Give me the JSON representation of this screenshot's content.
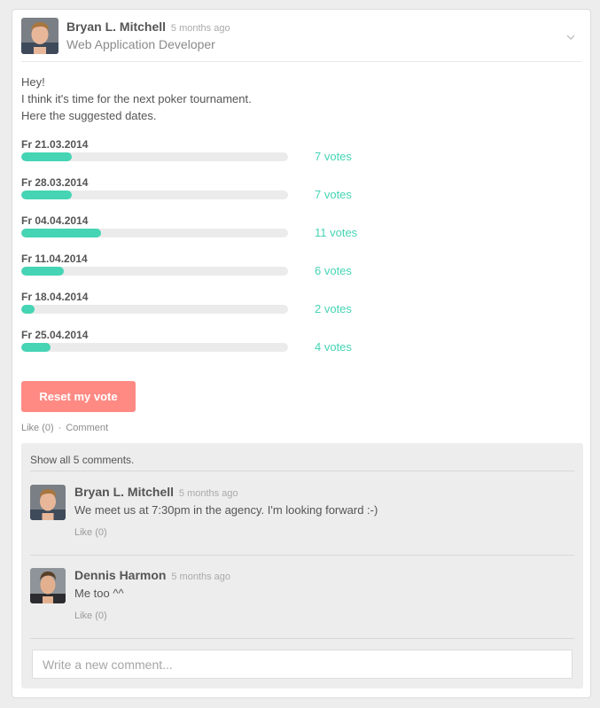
{
  "post": {
    "author": "Bryan L. Mitchell",
    "time": "5 months ago",
    "role": "Web Application Developer",
    "message": [
      "Hey!",
      "I think it's time for the next poker tournament.",
      "Here the suggested dates."
    ]
  },
  "poll": {
    "fill_color": "#45d4b4",
    "options": [
      {
        "date": "Fr 21.03.2014",
        "votes_label": "7 votes",
        "fill": 0.19
      },
      {
        "date": "Fr 28.03.2014",
        "votes_label": "7 votes",
        "fill": 0.19
      },
      {
        "date": "Fr 04.04.2014",
        "votes_label": "11 votes",
        "fill": 0.3
      },
      {
        "date": "Fr 11.04.2014",
        "votes_label": "6 votes",
        "fill": 0.16
      },
      {
        "date": "Fr 18.04.2014",
        "votes_label": "2 votes",
        "fill": 0.05
      },
      {
        "date": "Fr 25.04.2014",
        "votes_label": "4 votes",
        "fill": 0.11
      }
    ],
    "reset_label": "Reset my vote"
  },
  "actions": {
    "like": "Like (0)",
    "separator": "·",
    "comment": "Comment"
  },
  "comments": {
    "show_all": "Show all 5 comments.",
    "items": [
      {
        "author": "Bryan L. Mitchell",
        "time": "5 months ago",
        "text": "We meet us at 7:30pm in the agency. I'm looking forward :-)",
        "like": "Like (0)"
      },
      {
        "author": "Dennis Harmon",
        "time": "5 months ago",
        "text": "Me too ^^",
        "like": "Like (0)"
      }
    ],
    "placeholder": "Write a new comment..."
  },
  "colors": {
    "accent": "#45d4b4",
    "reset_button": "#ff8a84"
  }
}
